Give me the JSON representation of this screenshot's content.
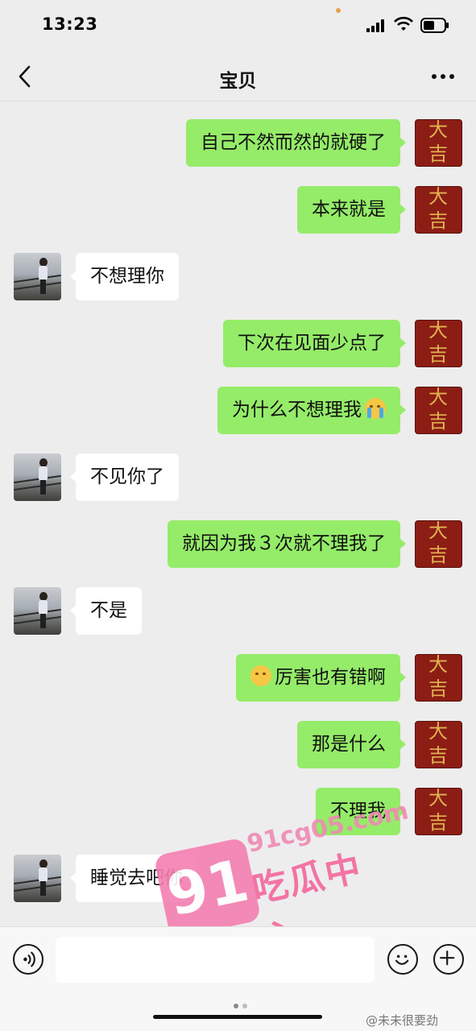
{
  "status_bar": {
    "time": "13:23",
    "icons": [
      "signal-icon",
      "wifi-icon",
      "battery-icon"
    ]
  },
  "header": {
    "title": "宝贝",
    "back_icon": "chevron-left-icon",
    "more_icon": "more-dots-icon"
  },
  "avatars": {
    "self": {
      "line1": "大",
      "line2": "吉"
    },
    "contact_icon": "contact-avatar-photo"
  },
  "messages": [
    {
      "side": "out",
      "text": "自己不然而然的就硬了"
    },
    {
      "side": "out",
      "text": "本来就是"
    },
    {
      "side": "in",
      "text": "不想理你"
    },
    {
      "side": "out",
      "text": "下次在见面少点了"
    },
    {
      "side": "out",
      "text": "为什么不想理我",
      "emoji_after": "crying-face-emoji"
    },
    {
      "side": "in",
      "text": "不见你了"
    },
    {
      "side": "out",
      "text": "就因为我３次就不理我了"
    },
    {
      "side": "in",
      "text": "不是"
    },
    {
      "side": "out",
      "text": "厉害也有错啊",
      "emoji_before": "persevering-face-emoji"
    },
    {
      "side": "out",
      "text": "那是什么"
    },
    {
      "side": "out",
      "text": "不理我"
    },
    {
      "side": "in",
      "text": "睡觉去吧你"
    }
  ],
  "input_bar": {
    "voice_icon": "voice-icon",
    "emoji_icon": "emoji-face-icon",
    "plus_icon": "plus-icon",
    "value": ""
  },
  "watermark": {
    "logo_number": "91",
    "url": "91cg05.com",
    "brand": "吃瓜中心"
  },
  "credit": {
    "text": "@未未很要劲"
  },
  "colors": {
    "background": "#ededed",
    "outgoing_bubble": "#95ec69",
    "incoming_bubble": "#ffffff",
    "self_avatar": "#8c1d15",
    "watermark_pink": "#f47fb1"
  }
}
